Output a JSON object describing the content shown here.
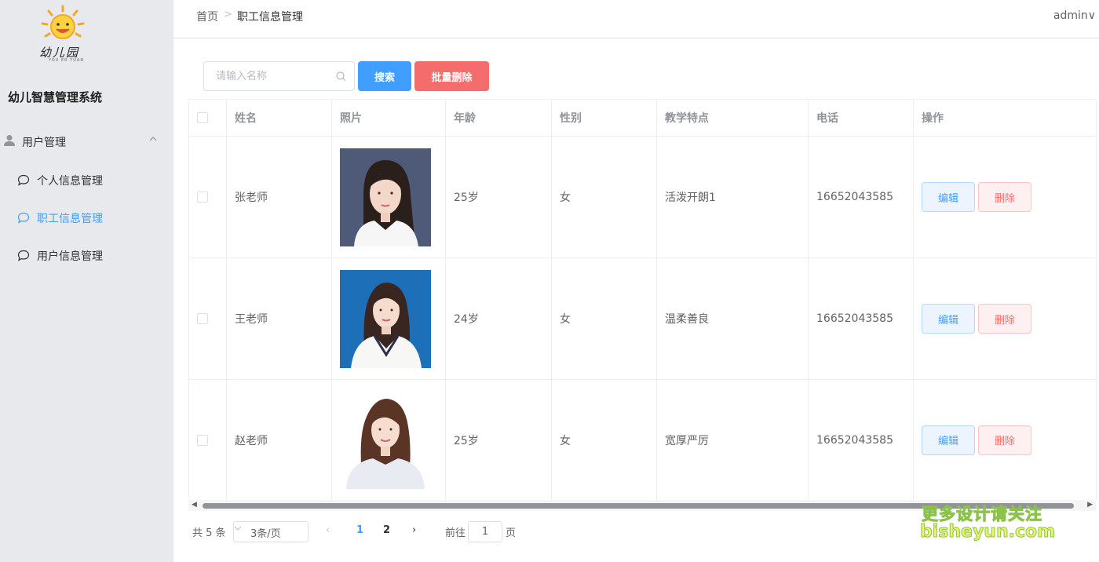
{
  "sidebar": {
    "logo_text": "幼儿园",
    "logo_sub": "YOU ER YUAN",
    "system_title": "幼儿智慧管理系统",
    "group_label": "用户管理",
    "items": [
      {
        "label": "个人信息管理",
        "active": false
      },
      {
        "label": "职工信息管理",
        "active": true
      },
      {
        "label": "用户信息管理",
        "active": false
      }
    ]
  },
  "header": {
    "breadcrumb_home": "首页",
    "breadcrumb_sep": ">",
    "breadcrumb_current": "职工信息管理",
    "user": "admin∨"
  },
  "toolbar": {
    "search_placeholder": "请输入名称",
    "search_label": "搜索",
    "batch_delete_label": "批量删除"
  },
  "table": {
    "headers": [
      "姓名",
      "照片",
      "年龄",
      "性别",
      "教学特点",
      "电话",
      "操作"
    ],
    "rows": [
      {
        "name": "张老师",
        "age": "25岁",
        "gender": "女",
        "feature": "活泼开朗1",
        "phone": "16652043585"
      },
      {
        "name": "王老师",
        "age": "24岁",
        "gender": "女",
        "feature": "温柔善良",
        "phone": "16652043585"
      },
      {
        "name": "赵老师",
        "age": "25岁",
        "gender": "女",
        "feature": "宽厚严厉",
        "phone": "16652043585"
      }
    ],
    "edit_label": "编辑",
    "delete_label": "删除"
  },
  "pagination": {
    "total": "共 5 条",
    "page_size": "3条/页",
    "prev": "‹",
    "pages": [
      "1",
      "2"
    ],
    "next": "›",
    "goto_label": "前往",
    "goto_value": "1",
    "page_suffix": "页"
  },
  "watermark": {
    "line1": "更多设计请关注",
    "line2": "bisheyun.com"
  },
  "colors": {
    "primary": "#409eff",
    "danger": "#f56c6c",
    "sidebar_bg": "#e8e9ec"
  }
}
